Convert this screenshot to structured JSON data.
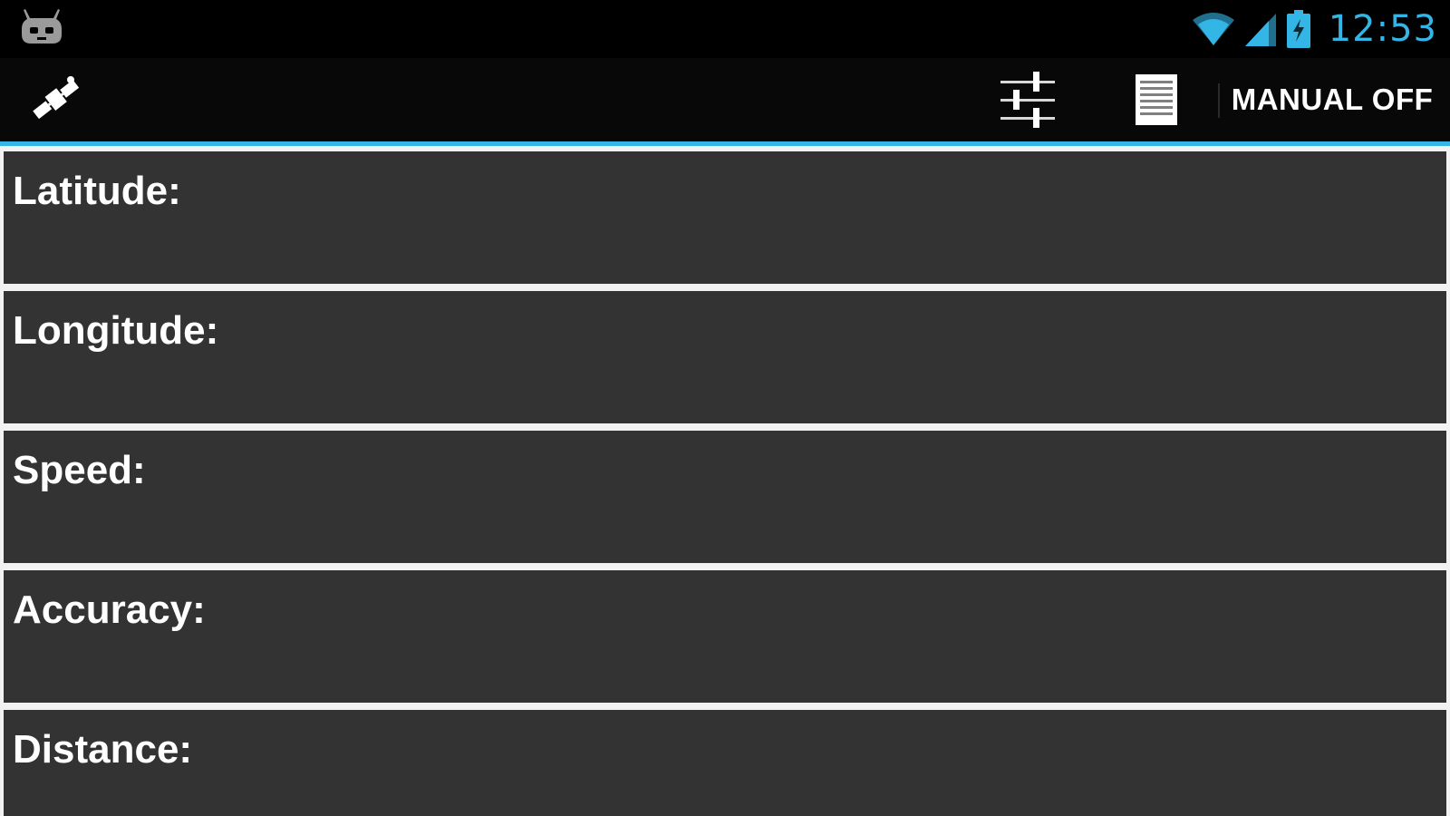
{
  "status_bar": {
    "time": "12:53",
    "icons": [
      "cyanogenmod-notification-icon",
      "wifi-icon",
      "cell-signal-icon",
      "battery-charging-icon"
    ],
    "accent_color": "#33b5e5"
  },
  "action_bar": {
    "app_icon": "satellite-icon",
    "settings_icon": "sliders-icon",
    "log_icon": "list-icon",
    "manual_toggle_label": "MANUAL OFF",
    "underline_color": "#33b5e5"
  },
  "fields": [
    {
      "label": "Latitude:",
      "value": ""
    },
    {
      "label": "Longitude:",
      "value": ""
    },
    {
      "label": "Speed:",
      "value": ""
    },
    {
      "label": "Accuracy:",
      "value": ""
    },
    {
      "label": "Distance:",
      "value": ""
    }
  ]
}
